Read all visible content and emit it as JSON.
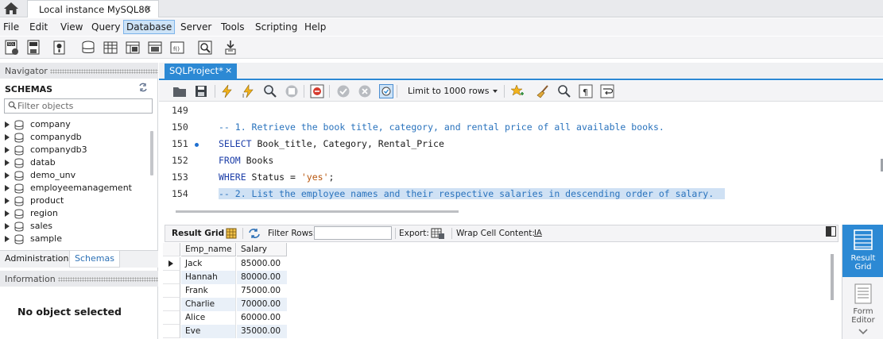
{
  "tabs": {
    "connection_title": "Local instance MySQL80",
    "close_glyph": "×"
  },
  "menu": [
    "File",
    "Edit",
    "View",
    "Query",
    "Database",
    "Server",
    "Tools",
    "Scripting",
    "Help"
  ],
  "menu_active": "Database",
  "sidebar": {
    "navigator_title": "Navigator",
    "schemas_heading": "SCHEMAS",
    "filter_placeholder": "Filter objects",
    "schemas": [
      "company",
      "companydb",
      "companydb3",
      "datab",
      "demo_unv",
      "employeemanagement",
      "product",
      "region",
      "sales",
      "sample"
    ],
    "bottom_tabs": [
      "Administration",
      "Schemas"
    ],
    "active_bottom_tab": "Schemas",
    "information_title": "Information",
    "no_object_text": "No object selected"
  },
  "query": {
    "tab_title": "SQLProject*",
    "limit_label": "Limit to 1000 rows"
  },
  "editor": {
    "lines": [
      {
        "num": "149",
        "text": ""
      },
      {
        "num": "150",
        "text": "-- 1. Retrieve the book title, category, and rental price of all available books."
      },
      {
        "num": "151",
        "text": "SELECT Book_title, Category, Rental_Price"
      },
      {
        "num": "152",
        "text": "FROM Books"
      },
      {
        "num": "153",
        "text": "WHERE Status = 'yes';"
      },
      {
        "num": "154",
        "text": "-- 2. List the employee names and their respective salaries in descending order of salary."
      }
    ],
    "selected_line": "154"
  },
  "result_toolbar": {
    "result_grid": "Result Grid",
    "filter_rows": "Filter Rows:",
    "export": "Export:",
    "wrap": "Wrap Cell Content:",
    "wrap_icon": "IA"
  },
  "grid": {
    "columns": [
      "Emp_name",
      "Salary"
    ],
    "rows": [
      [
        "Jack",
        "85000.00"
      ],
      [
        "Hannah",
        "80000.00"
      ],
      [
        "Frank",
        "75000.00"
      ],
      [
        "Charlie",
        "70000.00"
      ],
      [
        "Alice",
        "60000.00"
      ],
      [
        "Eve",
        "35000.00"
      ]
    ]
  },
  "right_panel": {
    "result_grid_label": "Result Grid",
    "form_editor_label": "Form Editor"
  },
  "colors": {
    "accent": "#2c89d4",
    "keyword": "#1c3ea8",
    "comment": "#2a73bd",
    "string": "#b8560d",
    "selection": "#cfe1f4",
    "alt_row": "#e9f0f8"
  }
}
